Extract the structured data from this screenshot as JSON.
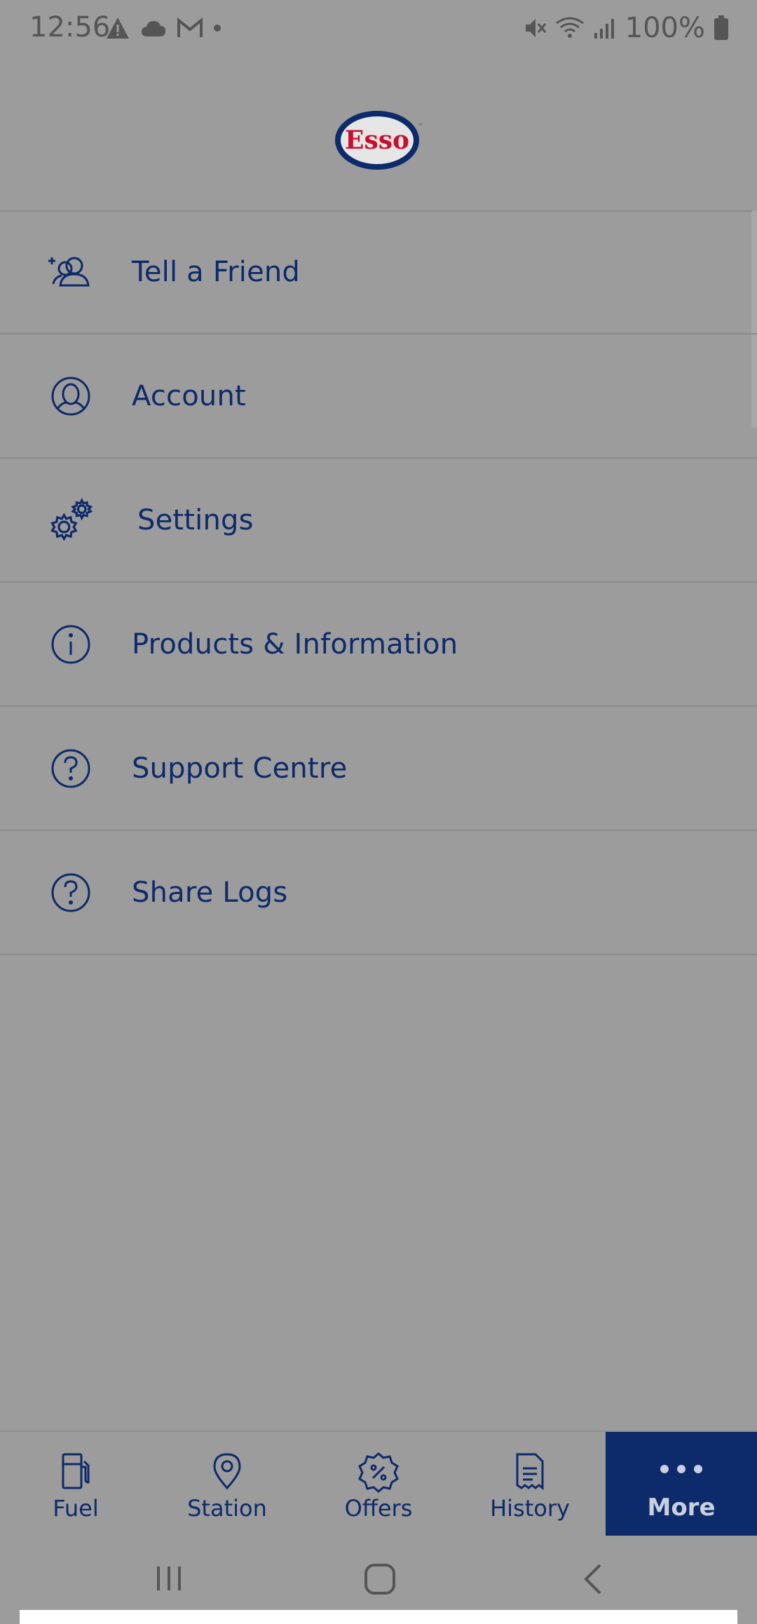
{
  "status_bar": {
    "time": "12:56",
    "battery": "100%"
  },
  "header": {
    "logo_text": "Esso"
  },
  "menu": {
    "items": [
      {
        "label": "Tell a Friend",
        "icon": "add-friend-icon"
      },
      {
        "label": "Account",
        "icon": "account-icon"
      },
      {
        "label": "Settings",
        "icon": "gears-icon"
      },
      {
        "label": "Products & Information",
        "icon": "info-icon"
      },
      {
        "label": "Support Centre",
        "icon": "question-icon"
      },
      {
        "label": "Share Logs",
        "icon": "question-icon"
      }
    ]
  },
  "bottom_nav": {
    "items": [
      {
        "label": "Fuel",
        "icon": "fuel-pump-icon"
      },
      {
        "label": "Station",
        "icon": "map-pin-icon"
      },
      {
        "label": "Offers",
        "icon": "percent-badge-icon"
      },
      {
        "label": "History",
        "icon": "receipt-icon"
      },
      {
        "label": "More",
        "icon": "more-dots-icon",
        "active": true
      }
    ]
  },
  "colors": {
    "accent": "#0d2a6b",
    "logo_red": "#c8102e",
    "overlay_bg": "#9c9c9c"
  }
}
